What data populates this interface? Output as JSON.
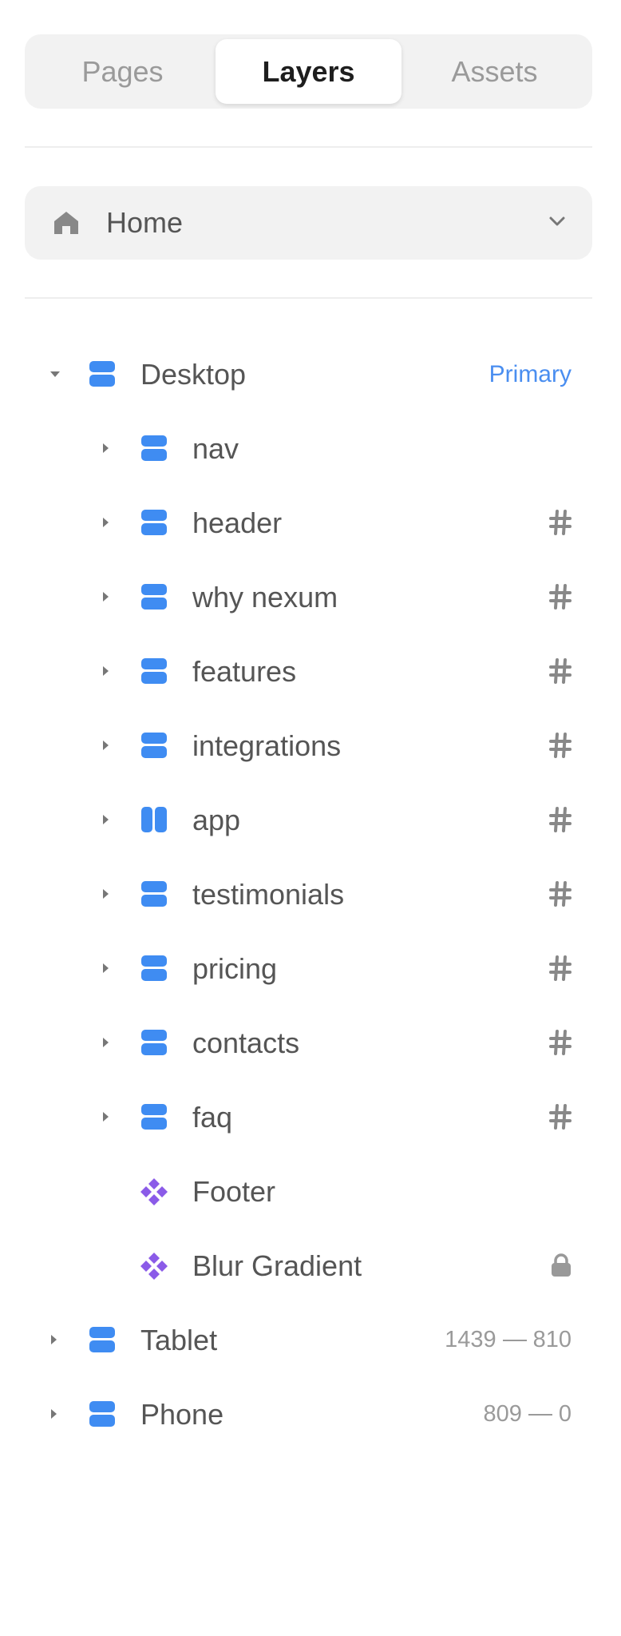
{
  "tabs": [
    {
      "label": "Pages",
      "active": false
    },
    {
      "label": "Layers",
      "active": true
    },
    {
      "label": "Assets",
      "active": false
    }
  ],
  "page_selector": {
    "label": "Home",
    "icon": "home-icon"
  },
  "colors": {
    "frame_icon": "#3f8cf2",
    "component_icon": "#8b5be8",
    "primary_badge": "#4a8ef0",
    "text": "#555555",
    "muted": "#9a9a9a"
  },
  "layers": {
    "desktop": {
      "name": "Desktop",
      "badge": "Primary",
      "expanded": true
    },
    "children": [
      {
        "name": "nav",
        "icon": "stack-icon",
        "anchor": false
      },
      {
        "name": "header",
        "icon": "stack-icon",
        "anchor": true
      },
      {
        "name": "why nexum",
        "icon": "stack-icon",
        "anchor": true
      },
      {
        "name": "features",
        "icon": "stack-icon",
        "anchor": true
      },
      {
        "name": "integrations",
        "icon": "stack-icon",
        "anchor": true
      },
      {
        "name": "app",
        "icon": "columns-icon",
        "anchor": true
      },
      {
        "name": "testimonials",
        "icon": "stack-icon",
        "anchor": true
      },
      {
        "name": "pricing",
        "icon": "stack-icon",
        "anchor": true
      },
      {
        "name": "contacts",
        "icon": "stack-icon",
        "anchor": true
      },
      {
        "name": "faq",
        "icon": "stack-icon",
        "anchor": true
      }
    ],
    "components": [
      {
        "name": "Footer",
        "icon": "component-icon",
        "locked": false
      },
      {
        "name": "Blur Gradient",
        "icon": "component-icon",
        "locked": true
      }
    ],
    "tablet": {
      "name": "Tablet",
      "range_start": "1439",
      "range_end": "810"
    },
    "phone": {
      "name": "Phone",
      "range_start": "809",
      "range_end": "0"
    }
  }
}
